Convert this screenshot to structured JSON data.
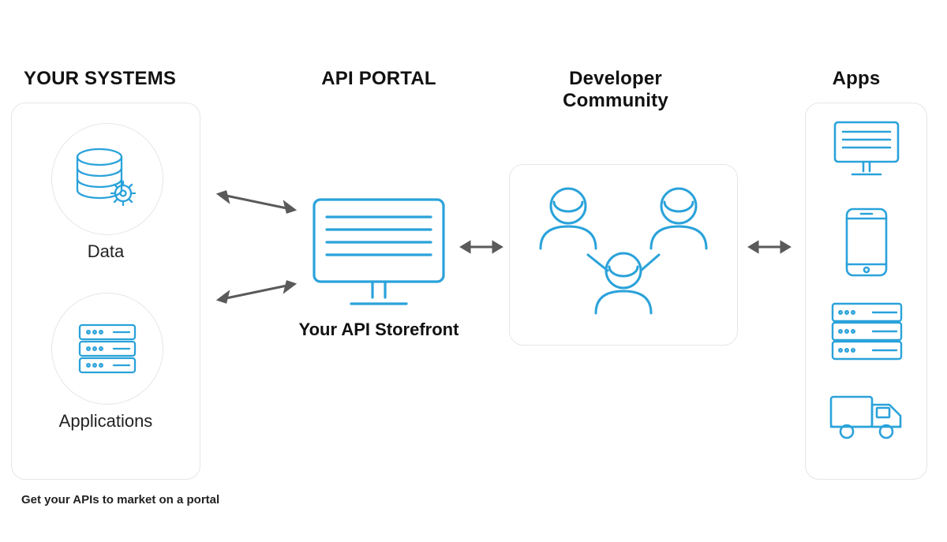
{
  "columns": {
    "your_systems": {
      "heading": "YOUR SYSTEMS",
      "items": {
        "data_label": "Data",
        "applications_label": "Applications"
      }
    },
    "api_portal": {
      "heading": "API PORTAL",
      "storefront_label": "Your API Storefront"
    },
    "developer_community": {
      "heading": "Developer\nCommunity"
    },
    "apps": {
      "heading": "Apps"
    }
  },
  "caption": "Get your APIs to market on a portal",
  "icons": {
    "data": "database-gear-icon",
    "applications": "server-icon",
    "storefront": "monitor-icon",
    "people": "people-group-icon",
    "app_monitor": "monitor-icon",
    "app_mobile": "smartphone-icon",
    "app_server": "server-icon",
    "app_truck": "truck-icon"
  },
  "colors": {
    "accent": "#2aa2da",
    "panel_border": "#e6e6e6",
    "arrow": "#5a5a5a"
  }
}
